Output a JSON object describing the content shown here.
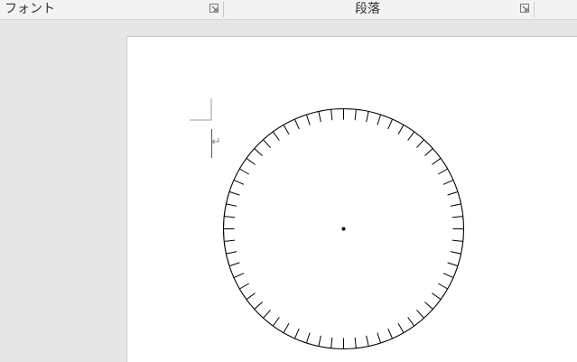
{
  "ribbon": {
    "groups": [
      {
        "label": "フォント",
        "launcher_icon": "dialog-launcher-icon"
      },
      {
        "label": "段落",
        "launcher_icon": "dialog-launcher-icon"
      }
    ]
  },
  "document": {
    "paragraph_mark": "↵",
    "drawing": {
      "shape": "clock-dial",
      "tick_count": 60,
      "center_dot": true,
      "stroke_color": "#000000"
    }
  }
}
